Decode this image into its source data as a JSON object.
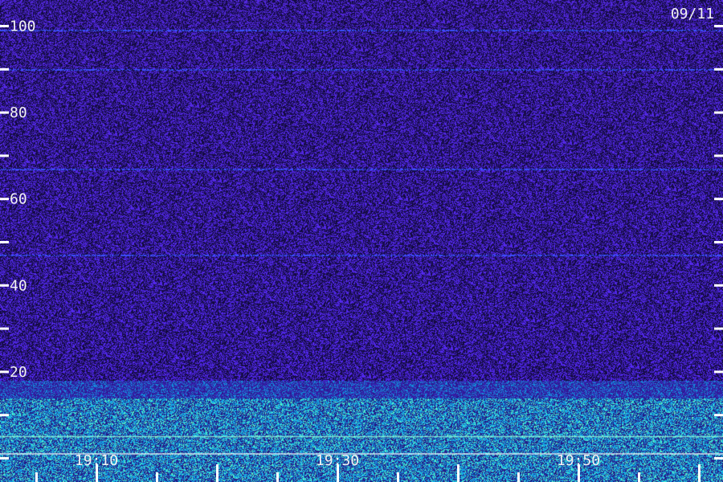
{
  "date_label": "09/11",
  "chart_data": {
    "type": "heatmap",
    "title": "",
    "xlabel": "",
    "ylabel": "",
    "y_range": [
      0,
      105
    ],
    "y_tick_labels": [
      "20",
      "40",
      "60",
      "80",
      "100"
    ],
    "y_tick_values": [
      0,
      10,
      20,
      30,
      40,
      50,
      60,
      70,
      80,
      90,
      100
    ],
    "x_tick_labels": [
      "19:10",
      "19:30",
      "19:50"
    ],
    "x_range": [
      "19:02",
      "20:02"
    ],
    "x_labeled_times": [
      "19:10",
      "19:30",
      "19:50"
    ],
    "x_minor_step_minutes": 5,
    "intensity_profile": [
      {
        "y_from": 0,
        "y_to": 14,
        "level": "high",
        "color": "#2ee890"
      },
      {
        "y_from": 14,
        "y_to": 18,
        "level": "medium",
        "color": "#1890ff"
      },
      {
        "y_from": 18,
        "y_to": 105,
        "level": "low",
        "color": "#3a1aa8"
      }
    ],
    "background_colors": {
      "low": "#140a4a",
      "mid": "#3a1aa8",
      "high": "#2ee890"
    },
    "grid": false,
    "legend": "none"
  }
}
